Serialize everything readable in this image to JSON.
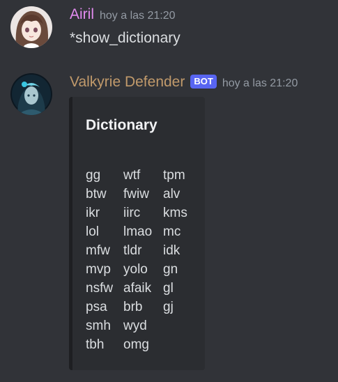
{
  "messages": [
    {
      "author": "Airil",
      "author_color": "#e38cf0",
      "timestamp": "hoy a las 21:20",
      "text": "*show_dictionary"
    },
    {
      "author": "Valkyrie Defender",
      "author_color": "#c19a6b",
      "bot_tag": "BOT",
      "timestamp": "hoy a las 21:20",
      "embed": {
        "title": "Dictionary",
        "columns": [
          [
            "gg",
            "btw",
            "ikr",
            "lol",
            "mfw",
            "mvp",
            "nsfw",
            "psa",
            "smh",
            "tbh"
          ],
          [
            "wtf",
            "fwiw",
            "iirc",
            "lmao",
            "tldr",
            "yolo",
            "afaik",
            "brb",
            "wyd",
            "omg"
          ],
          [
            "tpm",
            "alv",
            "kms",
            "mc",
            "idk",
            "gn",
            "gl",
            "gj"
          ]
        ]
      }
    }
  ],
  "icons": {
    "avatar_1": "anime-girl-avatar",
    "avatar_2": "dark-valkyrie-avatar"
  }
}
